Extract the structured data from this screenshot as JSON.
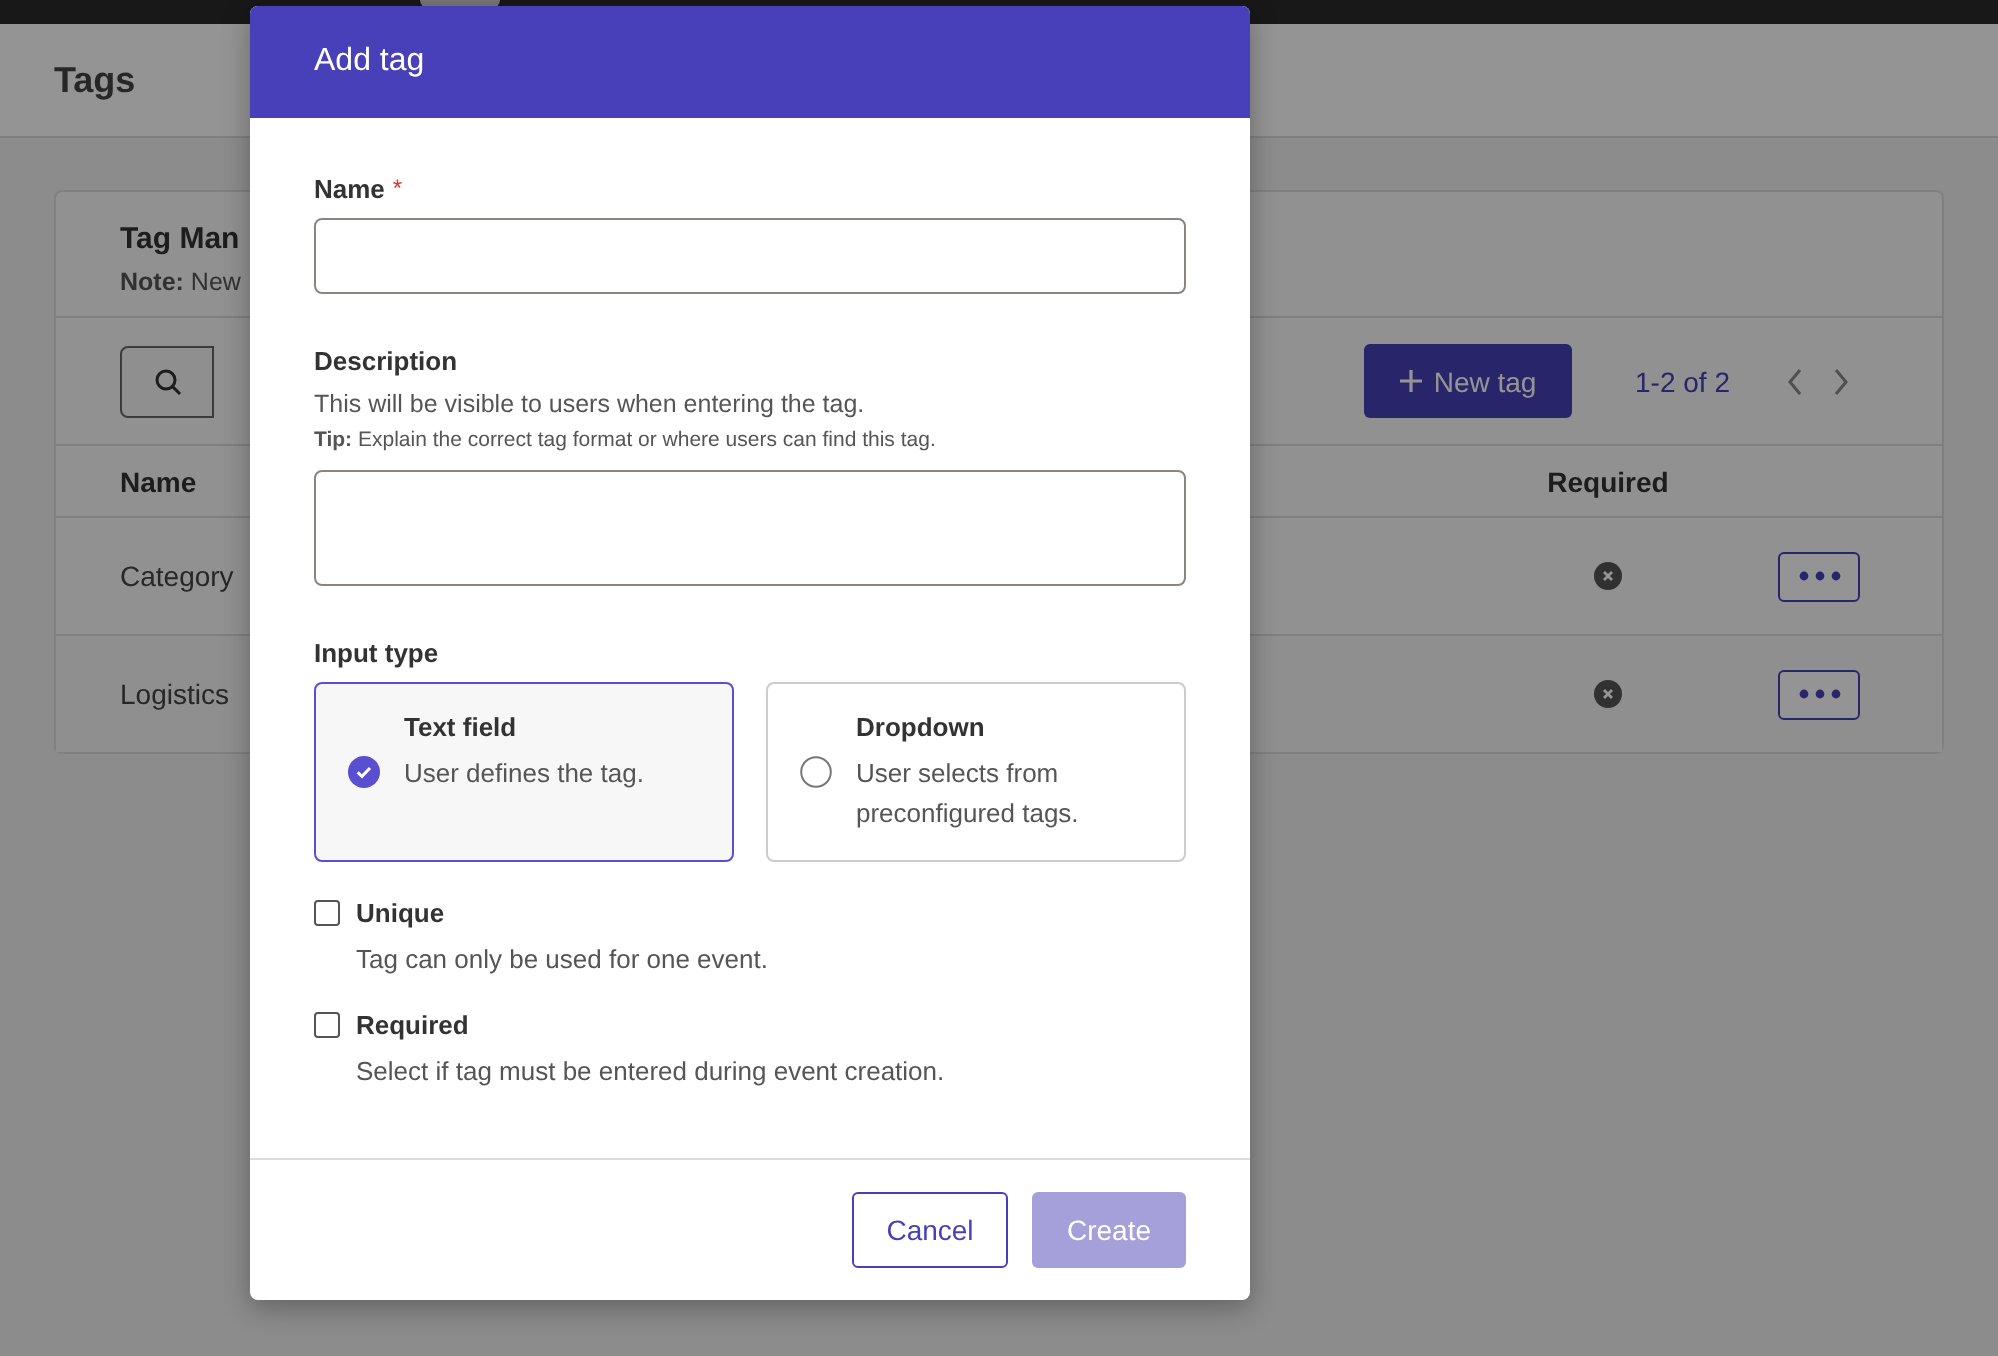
{
  "page": {
    "title": "Tags",
    "card": {
      "title": "Tag Man",
      "note": "**Note:** New",
      "toolbar": {
        "new_tag_button": "New tag",
        "pagination": "1-2 of 2"
      },
      "table": {
        "columns": [
          "Name",
          "Required"
        ],
        "rows": [
          {
            "name": "Category",
            "required": false
          },
          {
            "name": "Logistics",
            "required": false
          }
        ]
      }
    }
  },
  "dialog": {
    "title": "Add tag",
    "name_field": {
      "label": "Name",
      "required_mark": "*"
    },
    "description_field": {
      "label": "Description",
      "help": "This will be visible to users when entering the tag.",
      "tip": "**Tip:** Explain the correct tag format or where users can find this tag."
    },
    "input_type": {
      "label": "Input type",
      "options": [
        {
          "title": "Text field",
          "description": "User defines the tag.",
          "selected": true
        },
        {
          "title": "Dropdown",
          "description": "User selects from preconfigured tags.",
          "selected": false
        }
      ]
    },
    "checkboxes": [
      {
        "label": "Unique",
        "description": "Tag can only be used for one event.",
        "checked": false
      },
      {
        "label": "Required",
        "description": "Select if tag must be entered during event creation.",
        "checked": false
      }
    ],
    "buttons": {
      "cancel": "Cancel",
      "create": {
        "label": "Create",
        "disabled": true
      }
    }
  }
}
